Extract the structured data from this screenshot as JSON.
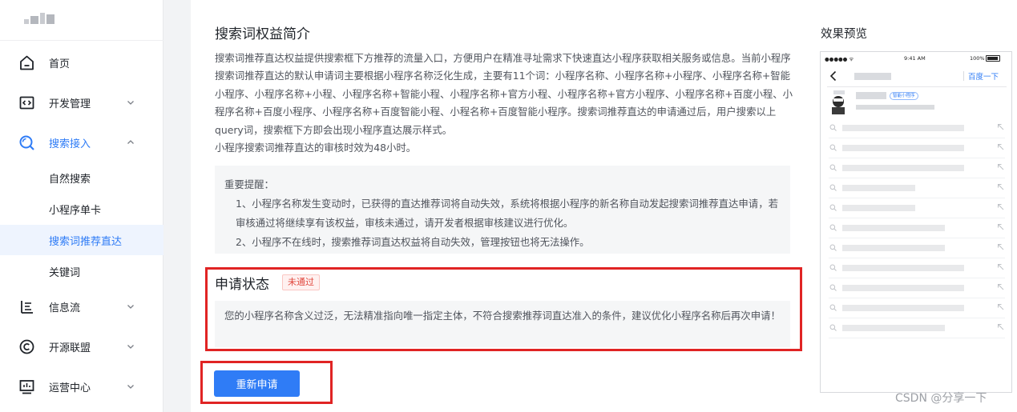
{
  "sidebar": {
    "nav": [
      {
        "label": "首页",
        "icon": "home-icon"
      },
      {
        "label": "开发管理",
        "icon": "code-icon"
      },
      {
        "label": "搜索接入",
        "icon": "search-icon"
      },
      {
        "label": "信息流",
        "icon": "feed-icon"
      },
      {
        "label": "开源联盟",
        "icon": "copyright-icon"
      },
      {
        "label": "运营中心",
        "icon": "chart-icon"
      }
    ],
    "search_sub": [
      {
        "label": "自然搜索"
      },
      {
        "label": "小程序单卡"
      },
      {
        "label": "搜索词推荐直达"
      },
      {
        "label": "关键词"
      }
    ]
  },
  "main": {
    "title": "搜索词权益简介",
    "intro": "搜索词推荐直达权益提供搜索框下方推荐的流量入口，方便用户在精准寻址需求下快速直达小程序获取相关服务或信息。当前小程序搜索词推荐直达的默认申请词主要根据小程序名称泛化生成，主要有11个词：小程序名称、小程序名称+小程序、小程序名称+智能小程序、小程序名称+小程、小程序名称+智能小程、小程序名称+官方小程、小程序名称+官方小程序、小程序名称+百度小程、小程序名称+百度小程序、小程序名称+百度智能小程、小程名称+百度智能小程序。搜索词推荐直达的申请通过后，用户搜索以上query词，搜索框下方即会出现小程序直达展示样式。",
    "review_time": "小程序搜索词推荐直达的审核时效为48小时。",
    "notice": {
      "title": "重要提醒：",
      "items": [
        "1、小程序名称发生变动时，已获得的直达推荐词将自动失效，系统将根据小程序的新名称自动发起搜索词推荐直达申请，若审核通过将继续享有该权益，审核未通过，请开发者根据审核建议进行优化。",
        "2、小程序不在线时，搜索推荐词直达权益将自动失效，管理按钮也将无法操作。"
      ]
    },
    "status": {
      "title": "申请状态",
      "badge": "未通过",
      "reason": "您的小程序名称含义过泛，无法精准指向唯一指定主体，不符合搜索推荐词直达准入的条件，建议优化小程序名称后再次申请！"
    },
    "reapply_button": "重新申请"
  },
  "preview": {
    "title": "效果预览",
    "status_signal": "●●●●● ᯤ",
    "time": "9:41 AM",
    "battery": "100%",
    "baidu_link": "百度一下",
    "mini_badge": "智能小程序"
  },
  "watermark": "CSDN @分享一下",
  "colors": {
    "accent": "#2f7cf6",
    "highlight_border": "#e02424",
    "badge_red": "#e0463c"
  }
}
